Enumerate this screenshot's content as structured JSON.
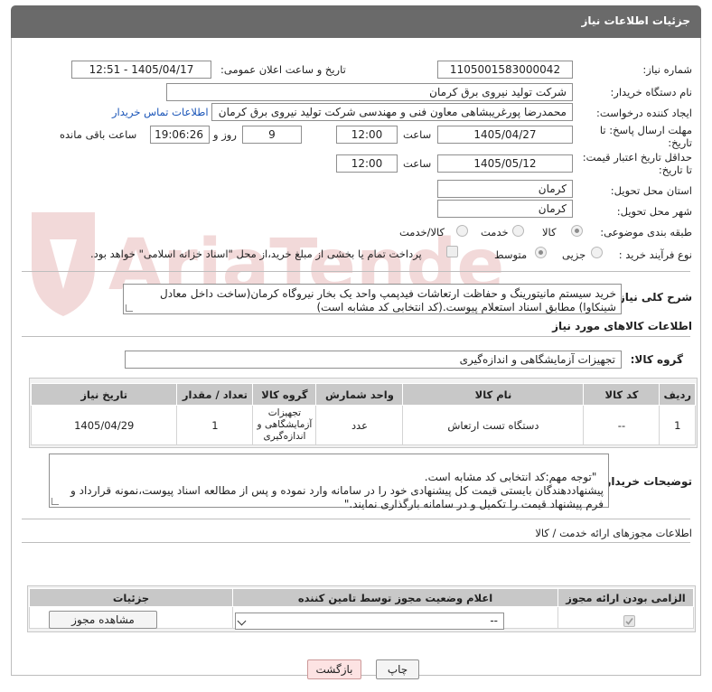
{
  "header": {
    "title": "جزئیات اطلاعات نیاز"
  },
  "fields": {
    "need_number_label": "شماره نیاز:",
    "need_number": "1105001583000042",
    "announce_label": "تاریخ و ساعت اعلان عمومی:",
    "announce_value": "1405/04/17 - 12:51",
    "buyer_org_label": "نام دستگاه خریدار:",
    "buyer_org": "شرکت تولید نیروی برق کرمان",
    "creator_label": "ایجاد کننده درخواست:",
    "creator": "محمدرضا پورغریبشاهی معاون فنی و مهندسی  شرکت تولید نیروی برق کرمان",
    "contact_link": "اطلاعات تماس خریدار",
    "deadline_label_1": "مهلت ارسال پاسخ: تا",
    "deadline_label_2": "تاریخ:",
    "deadline_date": "1405/04/27",
    "time_label": "ساعت",
    "deadline_time": "12:00",
    "days_value": "9",
    "days_label": "روز و",
    "remaining_time": "19:06:26",
    "remaining_label": "ساعت باقی مانده",
    "validity_label_1": "حداقل تاریخ اعتبار قیمت:",
    "validity_label_2": "تا تاریخ:",
    "validity_date": "1405/05/12",
    "validity_time": "12:00",
    "province_label": "استان محل تحویل:",
    "province": "کرمان",
    "city_label": "شهر محل تحویل:",
    "city": "کرمان",
    "category_label": "طبقه بندی موضوعی:",
    "category_options": [
      "کالا",
      "خدمت",
      "کالا/خدمت"
    ],
    "process_label": "نوع فرآیند خرید :",
    "process_options": [
      "جزیی",
      "متوسط"
    ],
    "payment_note": "پرداخت تمام یا بخشی از مبلغ خرید،از محل \"اسناد خزانه اسلامی\" خواهد بود."
  },
  "description": {
    "label": "شرح کلی نیاز:",
    "text": "خرید سیستم مانیتورینگ و حفاظت ارتعاشات فیدپمپ واحد یک بخار نیروگاه کرمان(ساخت داخل معادل شینکاوا) مطابق اسناد استعلام پیوست.(کد انتخابی کد مشابه است)"
  },
  "goods": {
    "section_title": "اطلاعات کالاهای مورد نیاز",
    "group_label": "گروه کالا:",
    "group_value": "تجهیزات آزمایشگاهی و اندازه‌گیری",
    "columns": [
      "ردیف",
      "کد کالا",
      "نام کالا",
      "واحد شمارش",
      "گروه کالا",
      "تعداد / مقدار",
      "تاریخ نیاز"
    ],
    "rows": [
      {
        "row": "1",
        "code": "--",
        "name": "دستگاه تست ارتعاش",
        "unit": "عدد",
        "group": "تجهیزات آزمایشگاهی و اندازه‌گیری",
        "qty": "1",
        "date": "1405/04/29"
      }
    ]
  },
  "buyer_notes": {
    "label": "توضیحات خریدار:",
    "text": "\"توجه مهم:کد انتخابی کد مشابه است.\nپیشنهاددهندگان بایستی قیمت کل پیشنهادی خود را در سامانه وارد نموده و پس از مطالعه اسناد پیوست،نمونه قرارداد و فرم پیشنهاد قیمت را تکمیل و در سامانه بارگذاری نمایند.\""
  },
  "permits": {
    "section_title": "اطلاعات مجوزهای ارائه خدمت / کالا",
    "columns": [
      "الزامی بودن ارائه مجوز",
      "اعلام وضعیت مجوز توسط تامین کننده",
      "جزئیات"
    ],
    "select_value": "--",
    "view_button": "مشاهده مجوز"
  },
  "footer": {
    "print_button": "چاپ",
    "back_button": "بازگشت"
  },
  "watermark": {
    "text": "AriaTender.net"
  }
}
